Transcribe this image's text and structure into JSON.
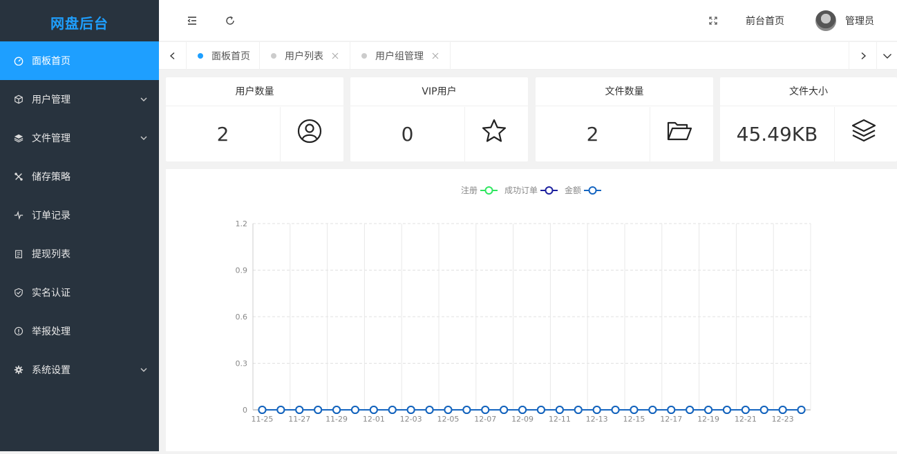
{
  "app": {
    "logo": "网盘后台"
  },
  "sidebar": {
    "items": [
      {
        "label": "面板首页",
        "icon": "dashboard-icon",
        "active": true,
        "has_children": false
      },
      {
        "label": "用户管理",
        "icon": "cube-icon",
        "active": false,
        "has_children": true
      },
      {
        "label": "文件管理",
        "icon": "layers-icon",
        "active": false,
        "has_children": true
      },
      {
        "label": "储存策略",
        "icon": "tools-icon",
        "active": false,
        "has_children": false
      },
      {
        "label": "订单记录",
        "icon": "pulse-icon",
        "active": false,
        "has_children": false
      },
      {
        "label": "提现列表",
        "icon": "clipboard-icon",
        "active": false,
        "has_children": false
      },
      {
        "label": "实名认证",
        "icon": "shield-check-icon",
        "active": false,
        "has_children": false
      },
      {
        "label": "举报处理",
        "icon": "info-icon",
        "active": false,
        "has_children": false
      },
      {
        "label": "系统设置",
        "icon": "gear-icon",
        "active": false,
        "has_children": true
      }
    ]
  },
  "header": {
    "front_home": "前台首页",
    "user_name": "管理员"
  },
  "tabs": [
    {
      "label": "面板首页",
      "active": true,
      "closable": false
    },
    {
      "label": "用户列表",
      "active": false,
      "closable": true
    },
    {
      "label": "用户组管理",
      "active": false,
      "closable": true
    }
  ],
  "cards": [
    {
      "title": "用户数量",
      "value": "2",
      "icon": "user-circle-icon"
    },
    {
      "title": "VIP用户",
      "value": "0",
      "icon": "star-icon"
    },
    {
      "title": "文件数量",
      "value": "2",
      "icon": "folder-open-icon"
    },
    {
      "title": "文件大小",
      "value": "45.49KB",
      "icon": "layers-icon"
    }
  ],
  "chart_data": {
    "type": "line",
    "legend_position": "top-center",
    "grid": true,
    "ylim": [
      0,
      1.2
    ],
    "yticks": [
      "0",
      "0.3",
      "0.6",
      "0.9",
      "1.2"
    ],
    "x": [
      "11-25",
      "11-26",
      "11-27",
      "11-28",
      "11-29",
      "11-30",
      "12-01",
      "12-02",
      "12-03",
      "12-04",
      "12-05",
      "12-06",
      "12-07",
      "12-08",
      "12-09",
      "12-10",
      "12-11",
      "12-12",
      "12-13",
      "12-14",
      "12-15",
      "12-16",
      "12-17",
      "12-18",
      "12-19",
      "12-20",
      "12-21",
      "12-22",
      "12-23",
      "12-24"
    ],
    "xtick_labels": [
      "11-25",
      "11-27",
      "11-29",
      "12-01",
      "12-03",
      "12-05",
      "12-07",
      "12-09",
      "12-11",
      "12-13",
      "12-15",
      "12-17",
      "12-19",
      "12-21",
      "12-23"
    ],
    "series": [
      {
        "name": "注册",
        "color": "#2ee65f",
        "values": [
          0,
          0,
          0,
          0,
          0,
          0,
          0,
          0,
          0,
          0,
          0,
          0,
          0,
          0,
          0,
          0,
          0,
          0,
          0,
          0,
          0,
          0,
          0,
          0,
          0,
          0,
          0,
          0,
          0,
          0
        ]
      },
      {
        "name": "成功订单",
        "color": "#1b1f9e",
        "values": [
          0,
          0,
          0,
          0,
          0,
          0,
          0,
          0,
          0,
          0,
          0,
          0,
          0,
          0,
          0,
          0,
          0,
          0,
          0,
          0,
          0,
          0,
          0,
          0,
          0,
          0,
          0,
          0,
          0,
          0
        ]
      },
      {
        "name": "金额",
        "color": "#1565c0",
        "values": [
          0,
          0,
          0,
          0,
          0,
          0,
          0,
          0,
          0,
          0,
          0,
          0,
          0,
          0,
          0,
          0,
          0,
          0,
          0,
          0,
          0,
          0,
          0,
          0,
          0,
          0,
          0,
          0,
          0,
          0
        ]
      }
    ]
  }
}
